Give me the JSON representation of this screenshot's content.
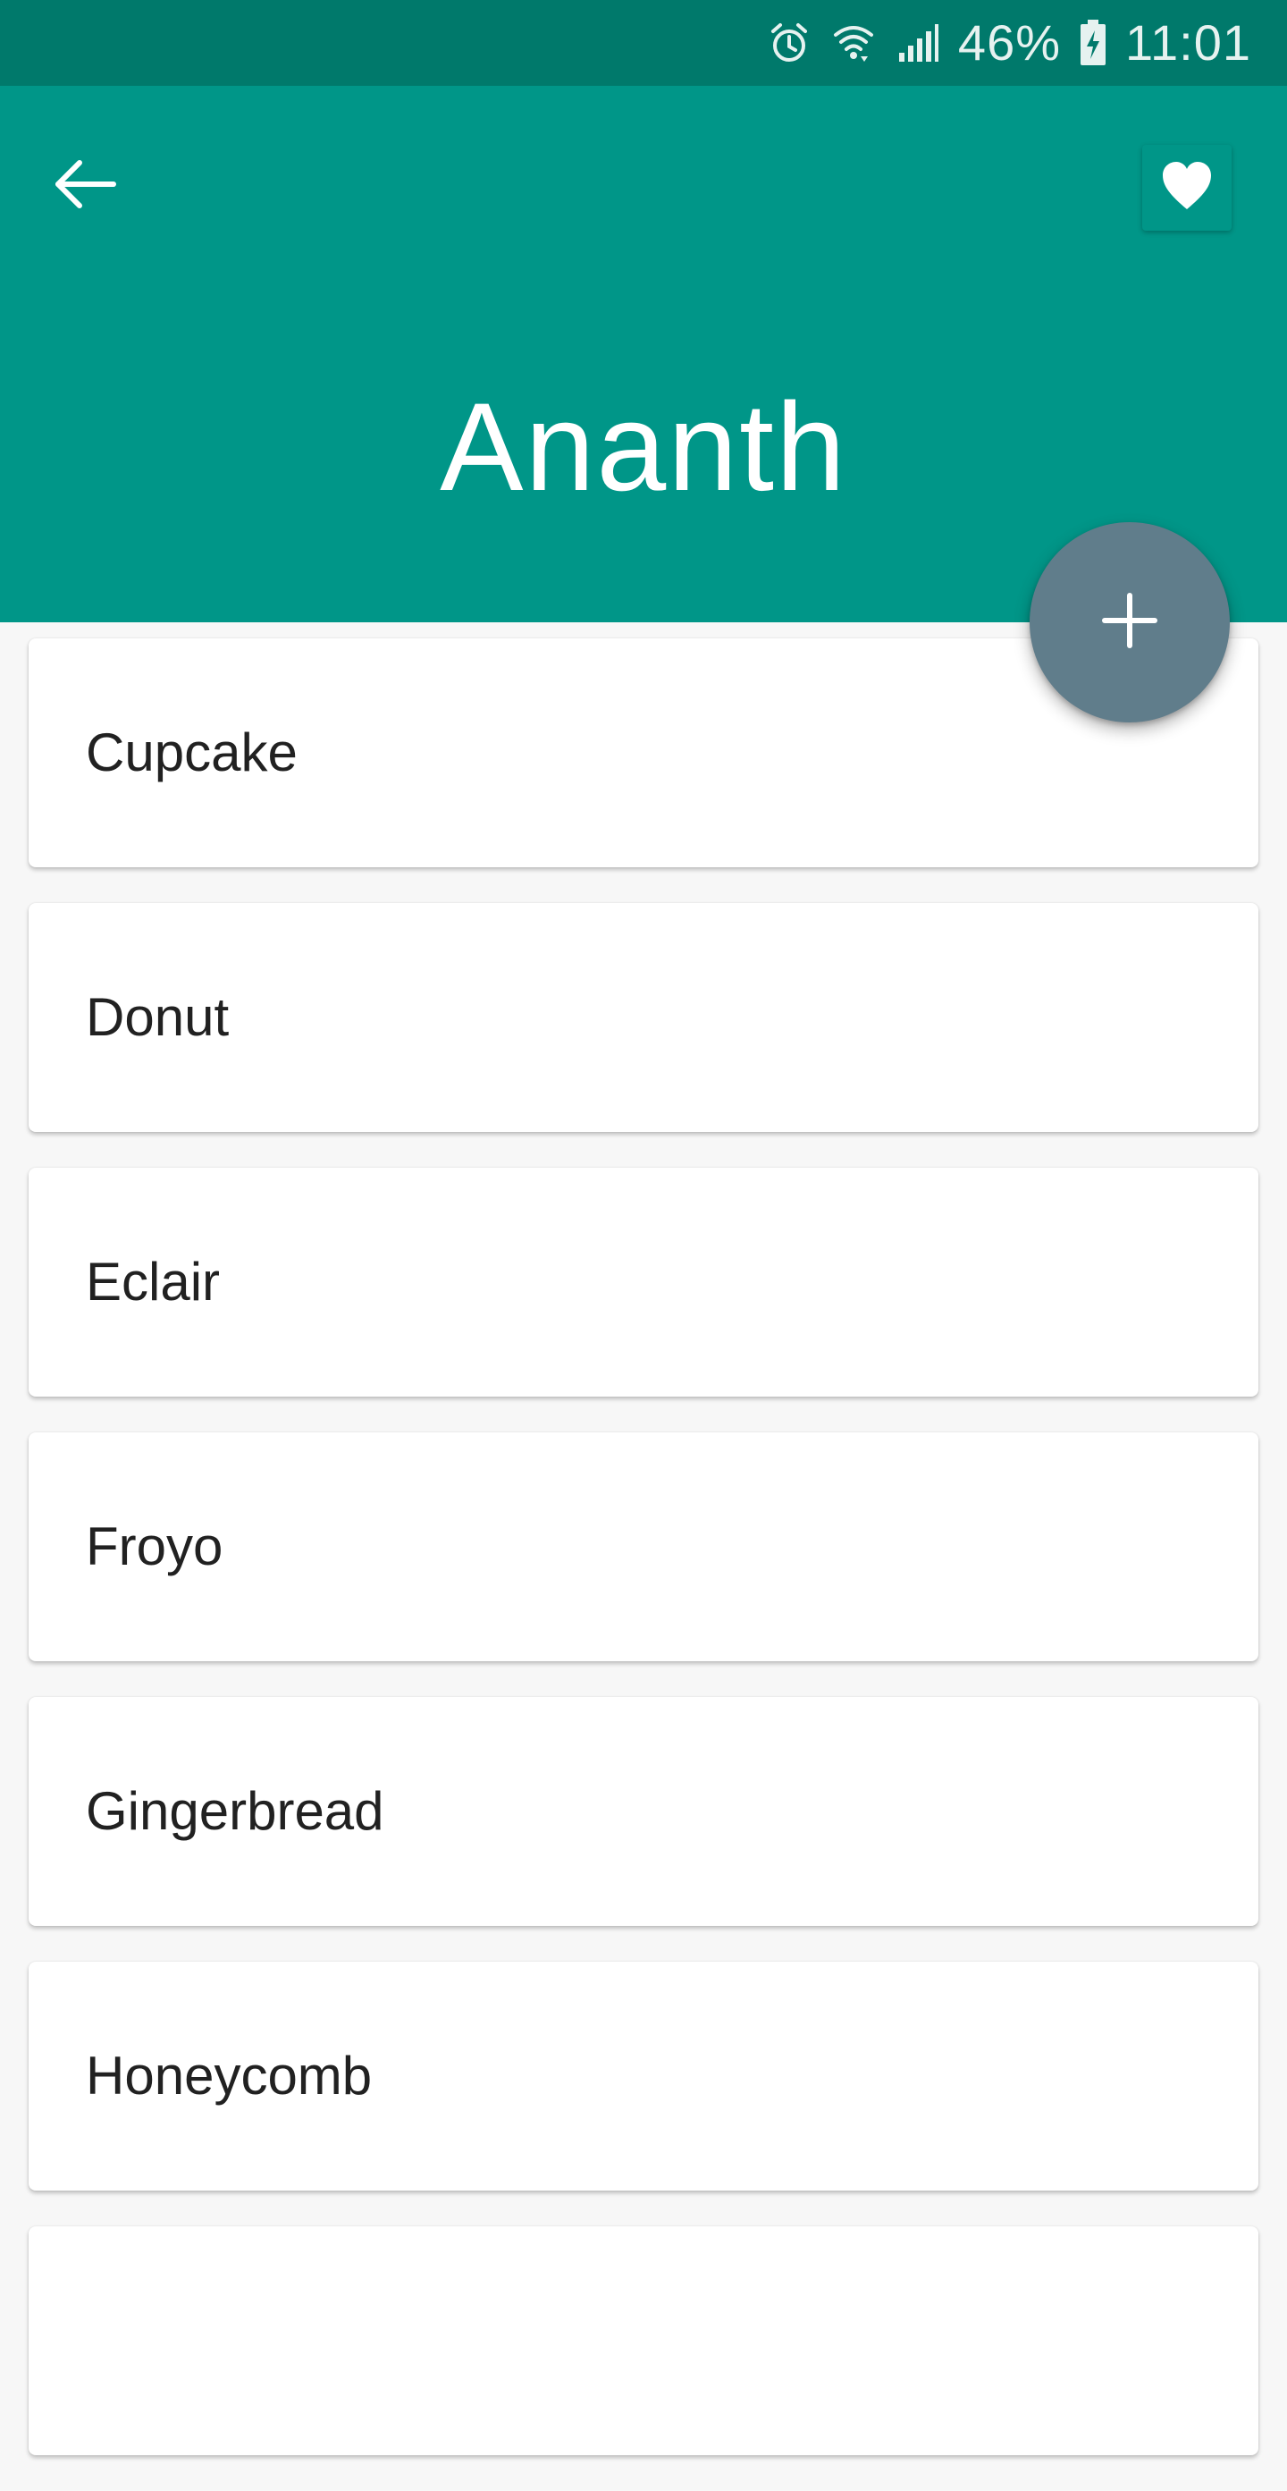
{
  "status_bar": {
    "battery_percent": "46%",
    "time": "11:01",
    "icons": [
      "alarm-icon",
      "wifi-icon",
      "signal-icon",
      "battery-charging-icon"
    ]
  },
  "app_bar": {
    "title": "Ananth",
    "back_icon": "arrow-left-icon",
    "favorite_icon": "heart-icon"
  },
  "fab": {
    "icon": "plus-icon"
  },
  "list": {
    "items": [
      {
        "label": "Cupcake"
      },
      {
        "label": "Donut"
      },
      {
        "label": "Eclair"
      },
      {
        "label": "Froyo"
      },
      {
        "label": "Gingerbread"
      },
      {
        "label": "Honeycomb"
      },
      {
        "label": ""
      }
    ]
  },
  "colors": {
    "status_bar": "#00796b",
    "app_bar": "#009688",
    "fab": "#607d8b",
    "background": "#f7f7f7",
    "card": "#ffffff",
    "text": "#212121"
  }
}
